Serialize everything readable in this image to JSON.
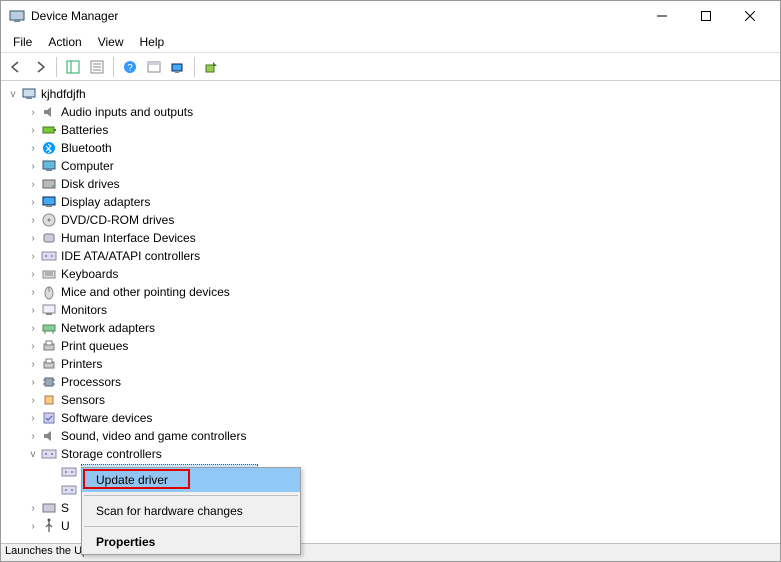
{
  "window": {
    "title": "Device Manager",
    "minimize_tip": "Minimize",
    "maximize_tip": "Maximize",
    "close_tip": "Close"
  },
  "menu": {
    "file": "File",
    "action": "Action",
    "view": "View",
    "help": "Help"
  },
  "tree": {
    "root": "kjhdfdjfh",
    "items": [
      "Audio inputs and outputs",
      "Batteries",
      "Bluetooth",
      "Computer",
      "Disk drives",
      "Display adapters",
      "DVD/CD-ROM drives",
      "Human Interface Devices",
      "IDE ATA/ATAPI controllers",
      "Keyboards",
      "Mice and other pointing devices",
      "Monitors",
      "Network adapters",
      "Print queues",
      "Printers",
      "Processors",
      "Sensors",
      "Software devices",
      "Sound, video and game controllers",
      "Storage controllers"
    ],
    "truncated_s": "S",
    "truncated_u": "U"
  },
  "context": {
    "update": "Update driver",
    "scan": "Scan for hardware changes",
    "properties": "Properties"
  },
  "status": "Launches the Update Driver Wizard for the selected device."
}
